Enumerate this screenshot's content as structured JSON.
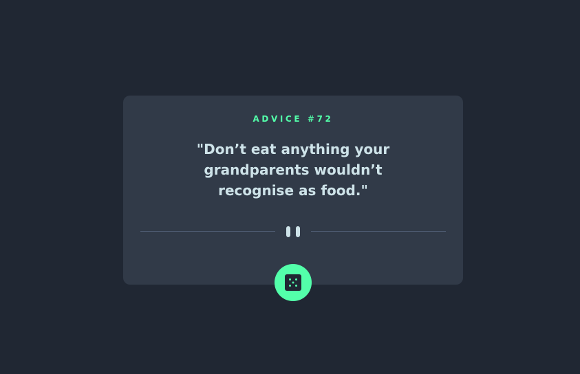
{
  "card": {
    "advice_id": "ADVICE #72",
    "quote": "\"Don’t eat anything your grandparents wouldn’t recognise as food.\""
  },
  "icons": {
    "divider": "pause-icon",
    "button": "dice-icon"
  },
  "colors": {
    "background": "#202733",
    "card": "#313A48",
    "accent": "#53FFAA",
    "text": "#CEE3E9",
    "divider": "#4F5D74"
  }
}
